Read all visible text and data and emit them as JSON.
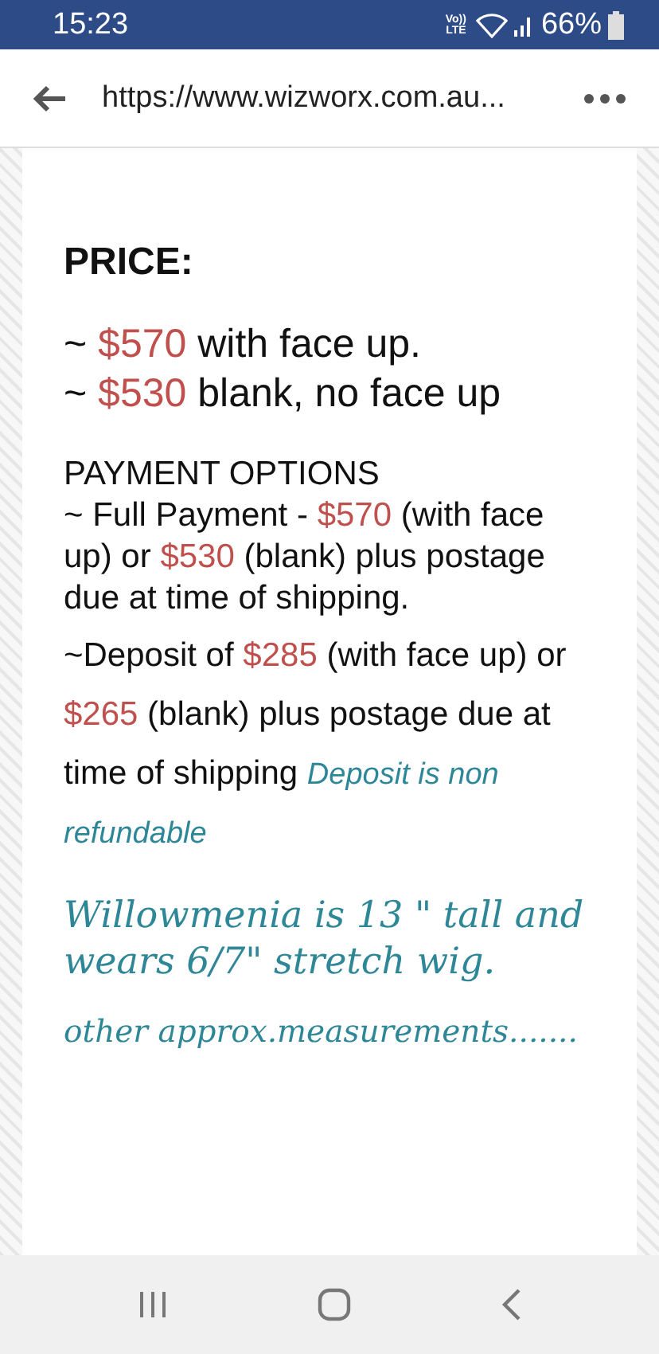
{
  "status_bar": {
    "time": "15:23",
    "network": [
      "Vo))",
      "LTE"
    ],
    "battery": "66%"
  },
  "address_bar": {
    "url": "https://www.wizworx.com.au..."
  },
  "content": [
    {
      "kind": "heading",
      "segments": [
        {
          "kind": "text",
          "text": "PRICE:"
        }
      ]
    },
    {
      "kind": "price_line",
      "segments": [
        {
          "kind": "text",
          "text": "~ "
        },
        {
          "kind": "price",
          "text": "$570"
        },
        {
          "kind": "text",
          "text": " with face up."
        }
      ]
    },
    {
      "kind": "price_line",
      "segments": [
        {
          "kind": "text",
          "text": "~ "
        },
        {
          "kind": "price",
          "text": "$530"
        },
        {
          "kind": "text",
          "text": " blank, no face up"
        }
      ]
    },
    {
      "kind": "body",
      "segments": [
        {
          "kind": "text",
          "text": "PAYMENT OPTIONS"
        }
      ]
    },
    {
      "kind": "body",
      "segments": [
        {
          "kind": "text",
          "text": "~ Full Payment - "
        },
        {
          "kind": "price",
          "text": "$570"
        },
        {
          "kind": "text",
          "text": " (with face up) or "
        },
        {
          "kind": "price",
          "text": "$530"
        },
        {
          "kind": "text",
          "text": " (blank) plus postage due at time of shipping."
        }
      ]
    },
    {
      "kind": "body_loose",
      "segments": [
        {
          "kind": "text",
          "text": "~Deposit of "
        },
        {
          "kind": "price",
          "text": "$285"
        },
        {
          "kind": "text",
          "text": " (with face up) or "
        },
        {
          "kind": "price",
          "text": "$265"
        },
        {
          "kind": "text",
          "text": " (blank) plus postage due at time of shipping "
        },
        {
          "kind": "note",
          "text": "Deposit is non refundable"
        }
      ]
    },
    {
      "kind": "serif_large",
      "segments": [
        {
          "kind": "text",
          "text": "Willowmenia is 13 \" tall and wears 6/7\" stretch wig."
        }
      ]
    },
    {
      "kind": "serif",
      "segments": [
        {
          "kind": "text",
          "text": "other approx.measurements......."
        }
      ]
    }
  ]
}
